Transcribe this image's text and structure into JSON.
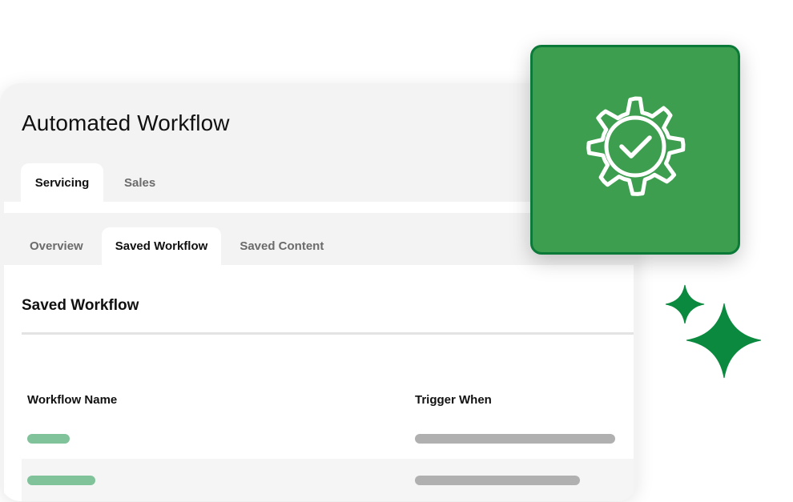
{
  "app": {
    "title": "Automated Workflow"
  },
  "top_tabs": [
    {
      "label": "Servicing",
      "active": true
    },
    {
      "label": "Sales",
      "active": false
    }
  ],
  "sub_tabs": [
    {
      "label": "Overview",
      "active": false
    },
    {
      "label": "Saved Workflow",
      "active": true
    },
    {
      "label": "Saved Content",
      "active": false
    }
  ],
  "panel": {
    "heading": "Saved Workflow",
    "columns": {
      "name": "Workflow Name",
      "trigger": "Trigger When"
    }
  },
  "icons": {
    "tile": "gear-check-icon",
    "decor": "sparkle-icon"
  },
  "colors": {
    "accent_green": "#3d9e4f",
    "accent_dark_green": "#0b7a38",
    "placeholder_green": "#80c299",
    "placeholder_gray": "#b0b0b0"
  }
}
